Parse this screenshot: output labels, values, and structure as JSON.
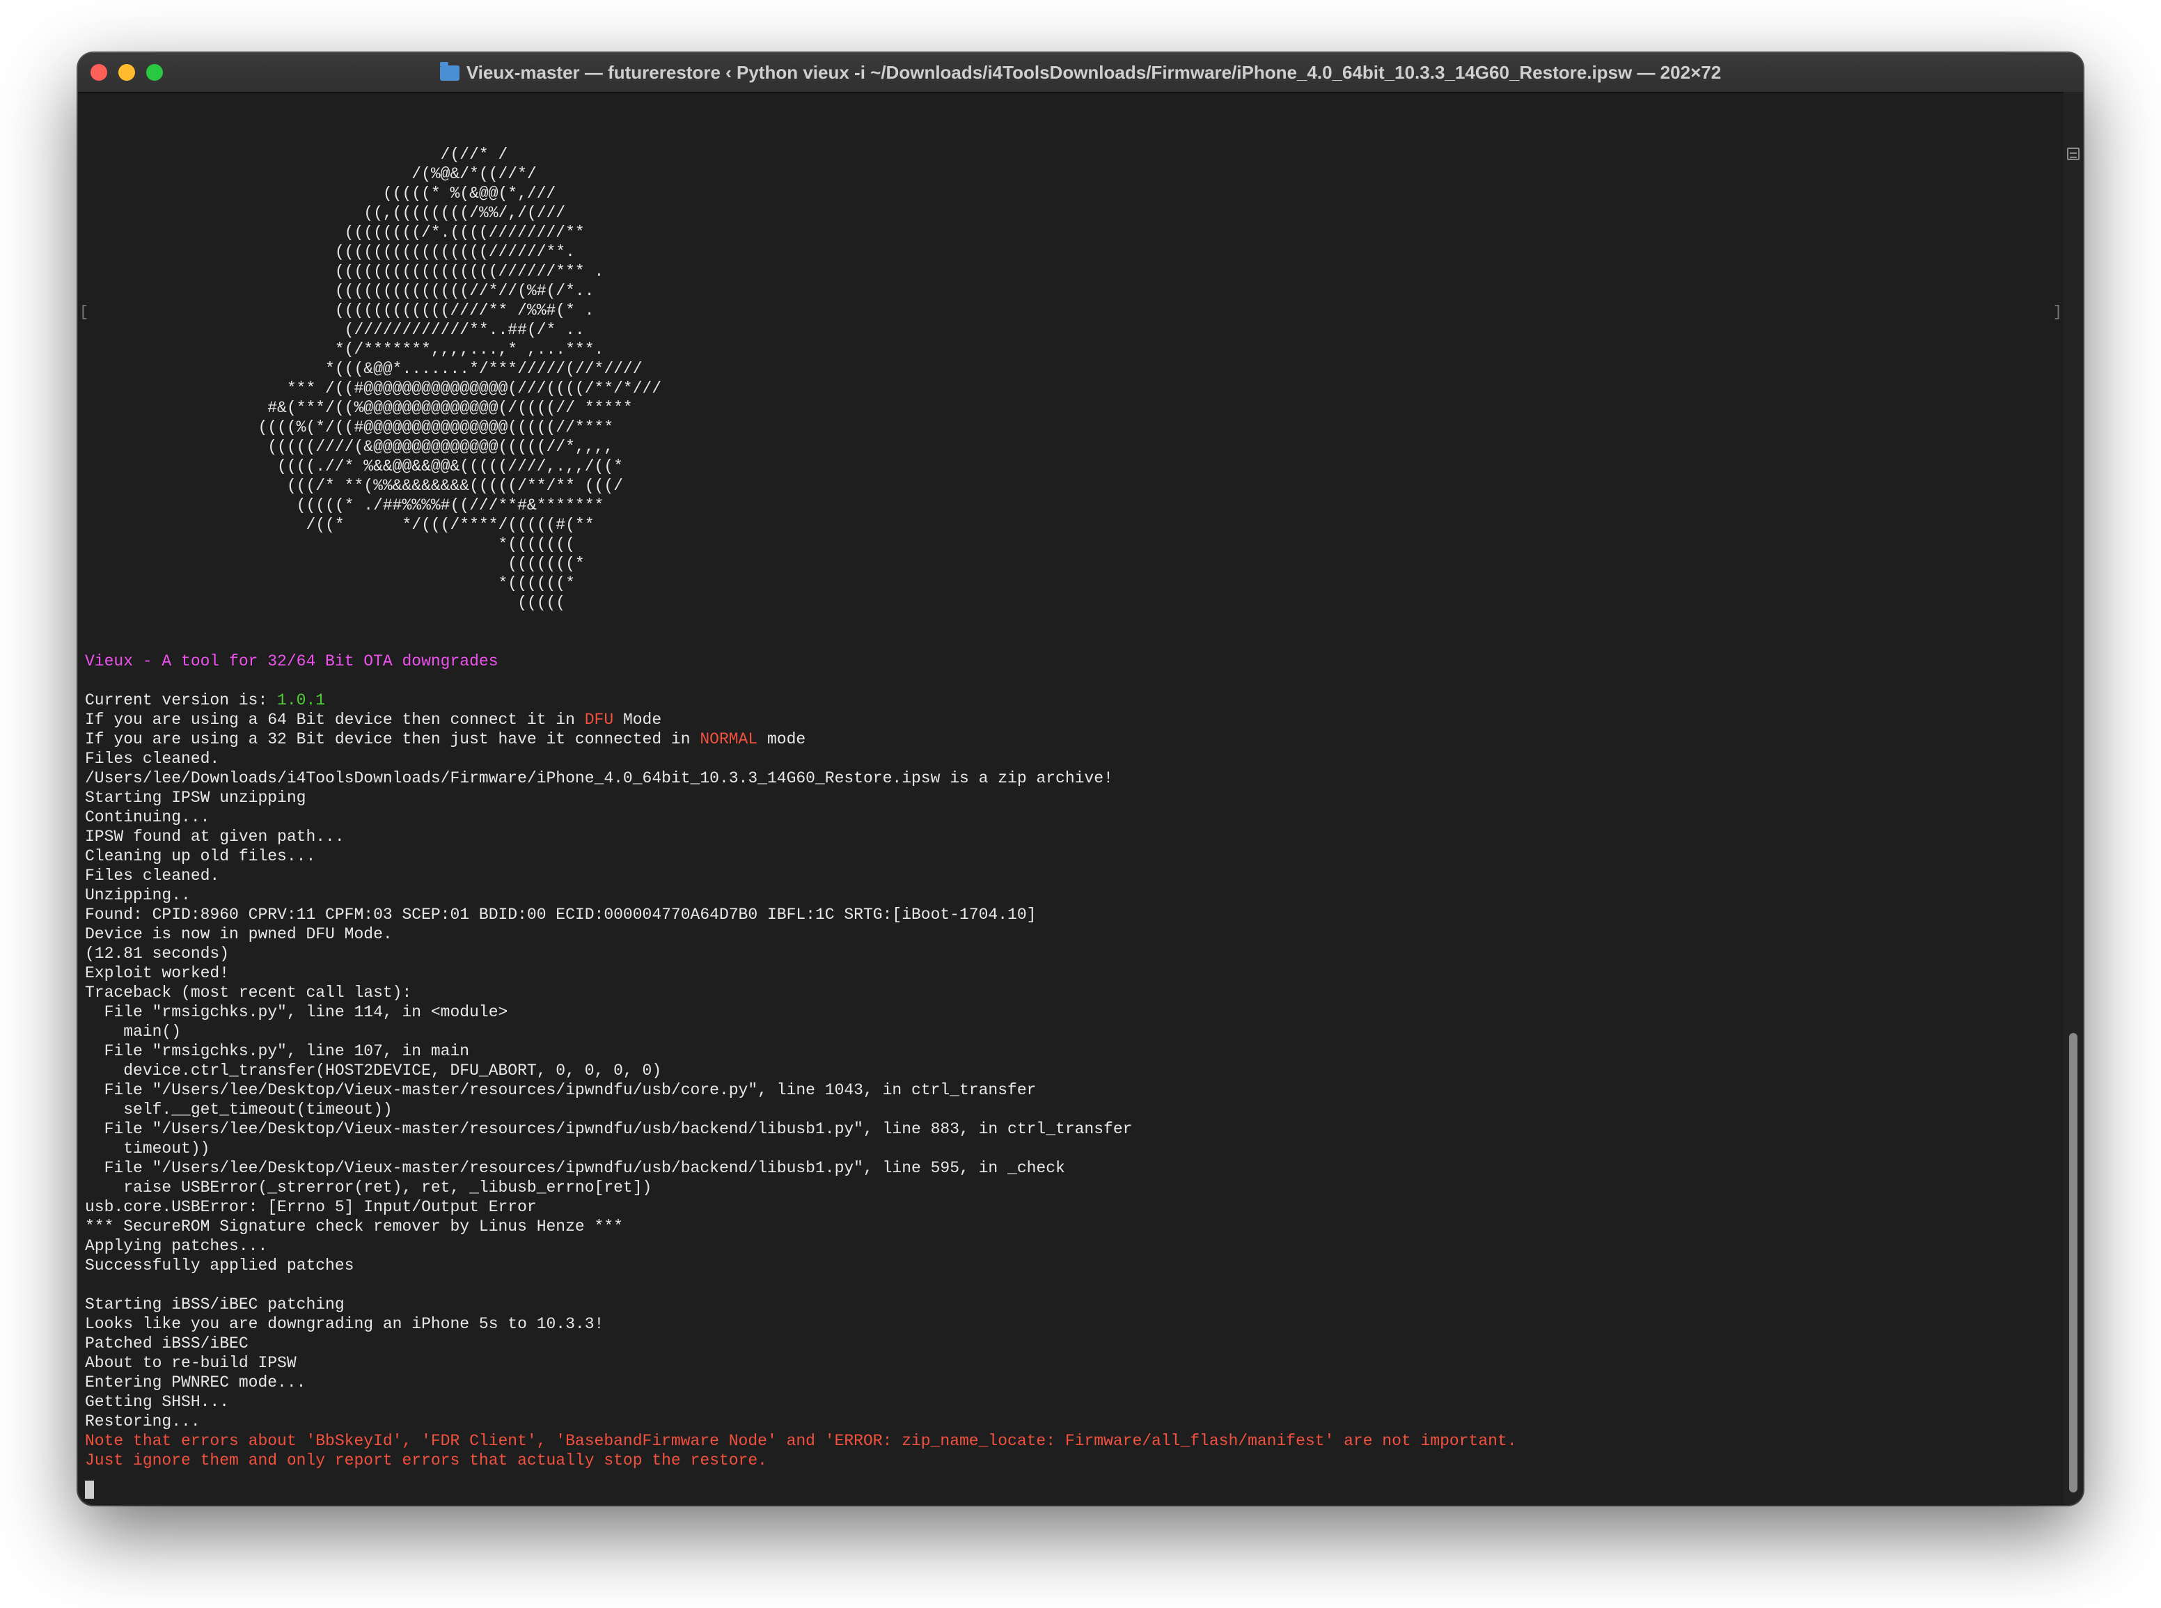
{
  "window": {
    "title": "Vieux-master — futurerestore ‹ Python vieux -i ~/Downloads/i4ToolsDownloads/Firmware/iPhone_4.0_64bit_10.3.3_14G60_Restore.ipsw — 202×72"
  },
  "terminal": {
    "ascii_art": [
      "                                     /(//* /",
      "                                  /(%@&/*((//*/",
      "                               (((((* %(&@@(*,///",
      "                             ((,((((((((/%%/,/(///",
      "                           ((((((((/*.((((////////**",
      "                          ((((((((((((((((//////**.",
      "                          (((((((((((((((((//////*** .",
      "                          ((((((((((((((//*//(%#(/*..",
      "                          ((((((((((((////** /%%#(* .",
      "                           (////////////**..##(/* ..",
      "                          *(/*******,,,,...,* ,...***.",
      "                         *(((&@@*.......*/***/////(//*////",
      "                     *** /((#@@@@@@@@@@@@@@@(///((((/**/*///",
      "                   #&(***/((%@@@@@@@@@@@@@@(/((((// *****",
      "                  ((((%(*/((#@@@@@@@@@@@@@@@(((((//****",
      "                   (((((////(&@@@@@@@@@@@@@(((((//*,,,,",
      "                    ((((.//* %&&@@&&@@&(((((////,.,,/((*",
      "                     (((/* **(%%&&&&&&&&(((((/**/** (((/",
      "                      (((((* ./##%%%%#((///**#&*******",
      "                       /((*      */(((/****/(((((#(**",
      "                                           *(((((((",
      "                                            (((((((*",
      "                                           *((((((*",
      "                                             ((((("
    ],
    "banner": "Vieux - A tool for 32/64 Bit OTA downgrades",
    "version_prefix": "Current version is: ",
    "version": "1.0.1",
    "dfu_prefix": "If you are using a 64 Bit device then connect it in ",
    "dfu_word": "DFU",
    "dfu_suffix": " Mode",
    "normal_prefix": "If you are using a 32 Bit device then just have it connected in ",
    "normal_word": "NORMAL",
    "normal_suffix": " mode",
    "log": [
      "Files cleaned.",
      "/Users/lee/Downloads/i4ToolsDownloads/Firmware/iPhone_4.0_64bit_10.3.3_14G60_Restore.ipsw is a zip archive!",
      "Starting IPSW unzipping",
      "Continuing...",
      "IPSW found at given path...",
      "Cleaning up old files...",
      "Files cleaned.",
      "Unzipping..",
      "Found: CPID:8960 CPRV:11 CPFM:03 SCEP:01 BDID:00 ECID:000004770A64D7B0 IBFL:1C SRTG:[iBoot-1704.10]",
      "Device is now in pwned DFU Mode.",
      "(12.81 seconds)",
      "Exploit worked!",
      "Traceback (most recent call last):",
      "  File \"rmsigchks.py\", line 114, in <module>",
      "    main()",
      "  File \"rmsigchks.py\", line 107, in main",
      "    device.ctrl_transfer(HOST2DEVICE, DFU_ABORT, 0, 0, 0, 0)",
      "  File \"/Users/lee/Desktop/Vieux-master/resources/ipwndfu/usb/core.py\", line 1043, in ctrl_transfer",
      "    self.__get_timeout(timeout))",
      "  File \"/Users/lee/Desktop/Vieux-master/resources/ipwndfu/usb/backend/libusb1.py\", line 883, in ctrl_transfer",
      "    timeout))",
      "  File \"/Users/lee/Desktop/Vieux-master/resources/ipwndfu/usb/backend/libusb1.py\", line 595, in _check",
      "    raise USBError(_strerror(ret), ret, _libusb_errno[ret])",
      "usb.core.USBError: [Errno 5] Input/Output Error",
      "*** SecureROM Signature check remover by Linus Henze ***",
      "Applying patches...",
      "Successfully applied patches"
    ],
    "log2": [
      "Starting iBSS/iBEC patching",
      "Looks like you are downgrading an iPhone 5s to 10.3.3!",
      "Patched iBSS/iBEC",
      "About to re-build IPSW",
      "Entering PWNREC mode...",
      "Getting SHSH...",
      "Restoring..."
    ],
    "notes": [
      "Note that errors about 'BbSkeyId', 'FDR Client', 'BasebandFirmware Node' and 'ERROR: zip_name_locate: Firmware/all_flash/manifest' are not important.",
      "Just ignore them and only report errors that actually stop the restore."
    ]
  },
  "colors": {
    "background": "#1e1e1e",
    "text": "#e8e8e8",
    "magenta": "#ee52ee",
    "green": "#4fcf37",
    "red": "#f2513f"
  },
  "icons": {
    "folder": "folder-icon",
    "close": "close-icon",
    "minimize": "minimize-icon",
    "maximize": "maximize-icon"
  }
}
